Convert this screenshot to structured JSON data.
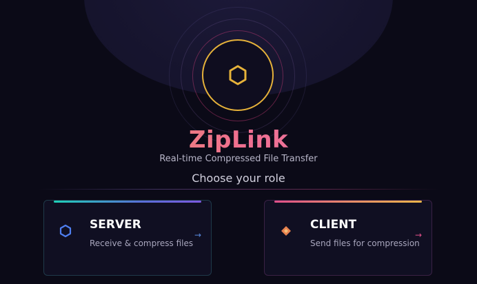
{
  "app": {
    "title": "ZipLink",
    "subtitle": "Real-time Compressed File Transfer",
    "prompt": "Choose your role",
    "logo_icon": "hexagon-icon"
  },
  "colors": {
    "background": "#0b0a17",
    "logo_ring": "#e6b23a",
    "server_accent_start": "#1fd0b8",
    "server_accent_end": "#7c5ae0",
    "client_accent_start": "#e0508a",
    "client_accent_end": "#ebb54a"
  },
  "roles": [
    {
      "id": "server",
      "title": "SERVER",
      "description": "Receive & compress files",
      "icon": "hexagon-outline-icon",
      "arrow": "→"
    },
    {
      "id": "client",
      "title": "CLIENT",
      "description": "Send files for compression",
      "icon": "diamond-icon",
      "arrow": "→"
    }
  ]
}
